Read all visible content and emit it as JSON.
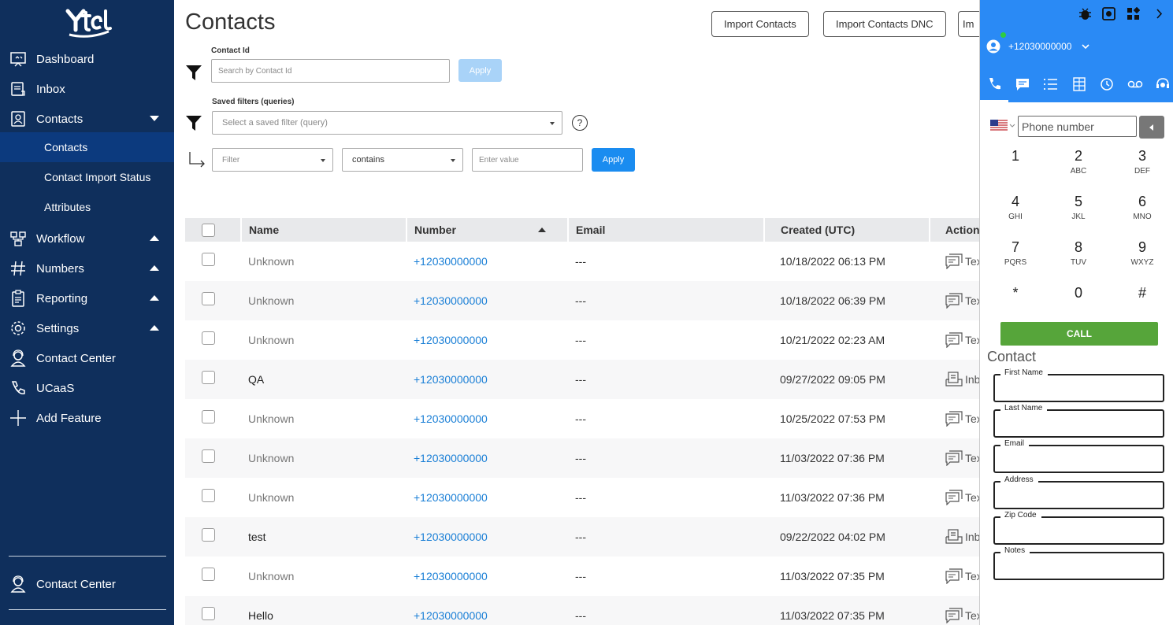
{
  "sidebar": {
    "logo": "Ytel",
    "items": [
      {
        "label": "Dashboard",
        "icon": "dashboard-icon"
      },
      {
        "label": "Inbox",
        "icon": "inbox-icon"
      },
      {
        "label": "Contacts",
        "icon": "contacts-icon"
      },
      {
        "label": "Workflow",
        "icon": "workflow-icon"
      },
      {
        "label": "Numbers",
        "icon": "hash-icon"
      },
      {
        "label": "Reporting",
        "icon": "clipboard-icon"
      },
      {
        "label": "Settings",
        "icon": "gear-icon"
      },
      {
        "label": "Contact Center",
        "icon": "agent-icon"
      },
      {
        "label": "UCaaS",
        "icon": "phone-icon"
      },
      {
        "label": "Add Feature",
        "icon": "plus-icon"
      }
    ],
    "subitems": [
      "Contacts",
      "Contact Import Status",
      "Attributes"
    ],
    "footer_label": "Contact Center"
  },
  "header": {
    "title": "Contacts",
    "buttons": [
      "Import Contacts",
      "Import Contacts DNC",
      "Im"
    ]
  },
  "filters": {
    "contact_id_label": "Contact Id",
    "contact_id_placeholder": "Search by Contact Id",
    "apply": "Apply",
    "saved_label": "Saved filters (queries)",
    "saved_placeholder": "Select a saved filter (query)",
    "help": "?",
    "field_placeholder": "Filter",
    "operator": "contains",
    "value_placeholder": "Enter value"
  },
  "table": {
    "columns": [
      "Name",
      "Number",
      "Email",
      "Created (UTC)",
      "Action"
    ],
    "rows": [
      {
        "name": "Unknown",
        "number": "+12030000000",
        "email": "---",
        "created": "10/18/2022 06:13 PM",
        "action": "Tex",
        "action_icon": "text-icon"
      },
      {
        "name": "Unknown",
        "number": "+12030000000",
        "email": "---",
        "created": "10/18/2022 06:39 PM",
        "action": "Tex",
        "action_icon": "text-icon"
      },
      {
        "name": "Unknown",
        "number": "+12030000000",
        "email": "---",
        "created": "10/21/2022 02:23 AM",
        "action": "Tex",
        "action_icon": "text-icon"
      },
      {
        "name": "QA",
        "number": "+12030000000",
        "email": "---",
        "created": "09/27/2022 09:05 PM",
        "action": "Inb",
        "action_icon": "inbox-icon"
      },
      {
        "name": "Unknown",
        "number": "+12030000000",
        "email": "---",
        "created": "10/25/2022 07:53 PM",
        "action": "Tex",
        "action_icon": "text-icon"
      },
      {
        "name": "Unknown",
        "number": "+12030000000",
        "email": "---",
        "created": "11/03/2022 07:36 PM",
        "action": "Tex",
        "action_icon": "text-icon"
      },
      {
        "name": "Unknown",
        "number": "+12030000000",
        "email": "---",
        "created": "11/03/2022 07:36 PM",
        "action": "Tex",
        "action_icon": "text-icon"
      },
      {
        "name": "test",
        "number": "+12030000000",
        "email": "---",
        "created": "09/22/2022 04:02 PM",
        "action": "Inb",
        "action_icon": "inbox-icon"
      },
      {
        "name": "Unknown",
        "number": "+12030000000",
        "email": "---",
        "created": "11/03/2022 07:35 PM",
        "action": "Tex",
        "action_icon": "text-icon"
      },
      {
        "name": "Hello",
        "number": "+12030000000",
        "email": "---",
        "created": "11/03/2022 07:35 PM",
        "action": "Tex",
        "action_icon": "text-icon"
      }
    ]
  },
  "dialer": {
    "number": "+12030000000",
    "phone_placeholder": "Phone number",
    "keys": [
      {
        "d": "1",
        "l": ""
      },
      {
        "d": "2",
        "l": "ABC"
      },
      {
        "d": "3",
        "l": "DEF"
      },
      {
        "d": "4",
        "l": "GHI"
      },
      {
        "d": "5",
        "l": "JKL"
      },
      {
        "d": "6",
        "l": "MNO"
      },
      {
        "d": "7",
        "l": "PQRS"
      },
      {
        "d": "8",
        "l": "TUV"
      },
      {
        "d": "9",
        "l": "WXYZ"
      },
      {
        "d": "*",
        "l": ""
      },
      {
        "d": "0",
        "l": ""
      },
      {
        "d": "#",
        "l": ""
      }
    ],
    "call": "CALL",
    "contact_title": "Contact",
    "fields": [
      "First Name",
      "Last Name",
      "Email",
      "Address",
      "Zip Code",
      "Notes"
    ]
  },
  "colors": {
    "sidebar": "#0f2f5c",
    "sidebar_active": "#0c3a7e",
    "link": "#1a7fd6",
    "apply": "#1a8cf0",
    "apply_disabled": "#a9d3f8",
    "dialer_header": "#2a8af5",
    "call": "#56a53a",
    "status_online": "#2ecc40"
  }
}
